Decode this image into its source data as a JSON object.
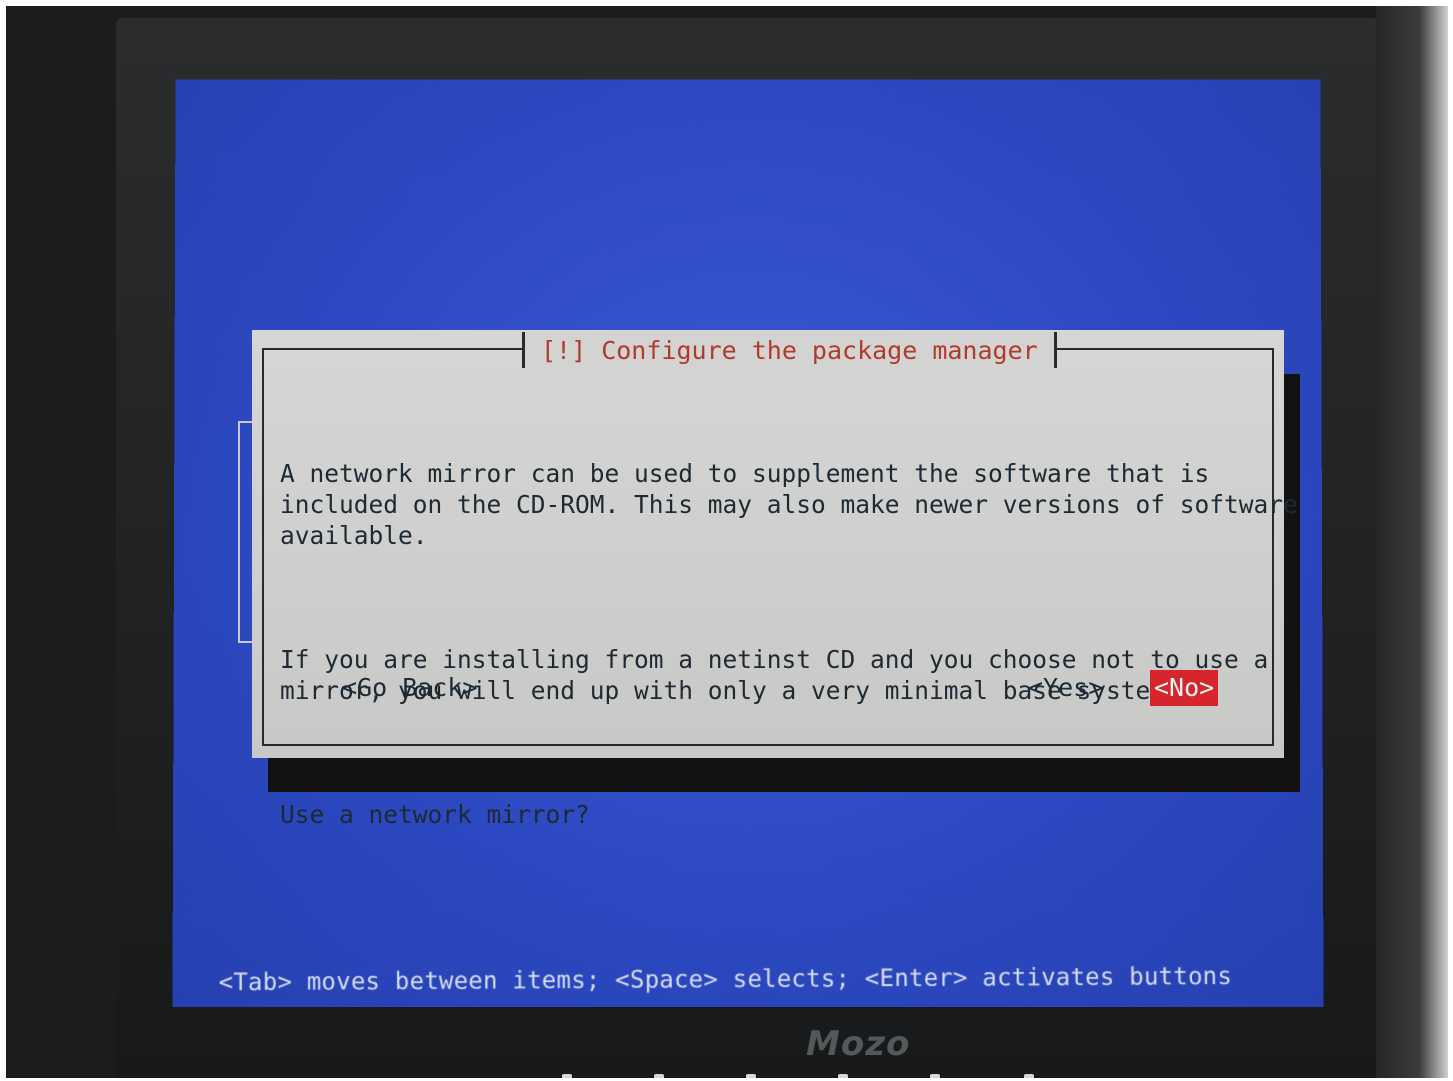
{
  "installer": {
    "dialog_title": "[!] Configure the package manager",
    "paragraphs": [
      "A network mirror can be used to supplement the software that is\nincluded on the CD-ROM. This may also make newer versions of software\navailable.",
      "If you are installing from a netinst CD and you choose not to use a\nmirror, you will end up with only a very minimal base system.",
      "Use a network mirror?"
    ],
    "buttons": {
      "go_back": "<Go Back>",
      "yes": "<Yes>",
      "no": "<No>"
    },
    "status_bar": "<Tab> moves between items; <Space> selects; <Enter> activates buttons"
  },
  "monitor": {
    "brand": "Mozo"
  },
  "colors": {
    "screen_blue": "#2d49c2",
    "dialog_gray": "#cfcfcd",
    "title_red": "#b23a2c",
    "selected_button_red": "#d5262c"
  }
}
